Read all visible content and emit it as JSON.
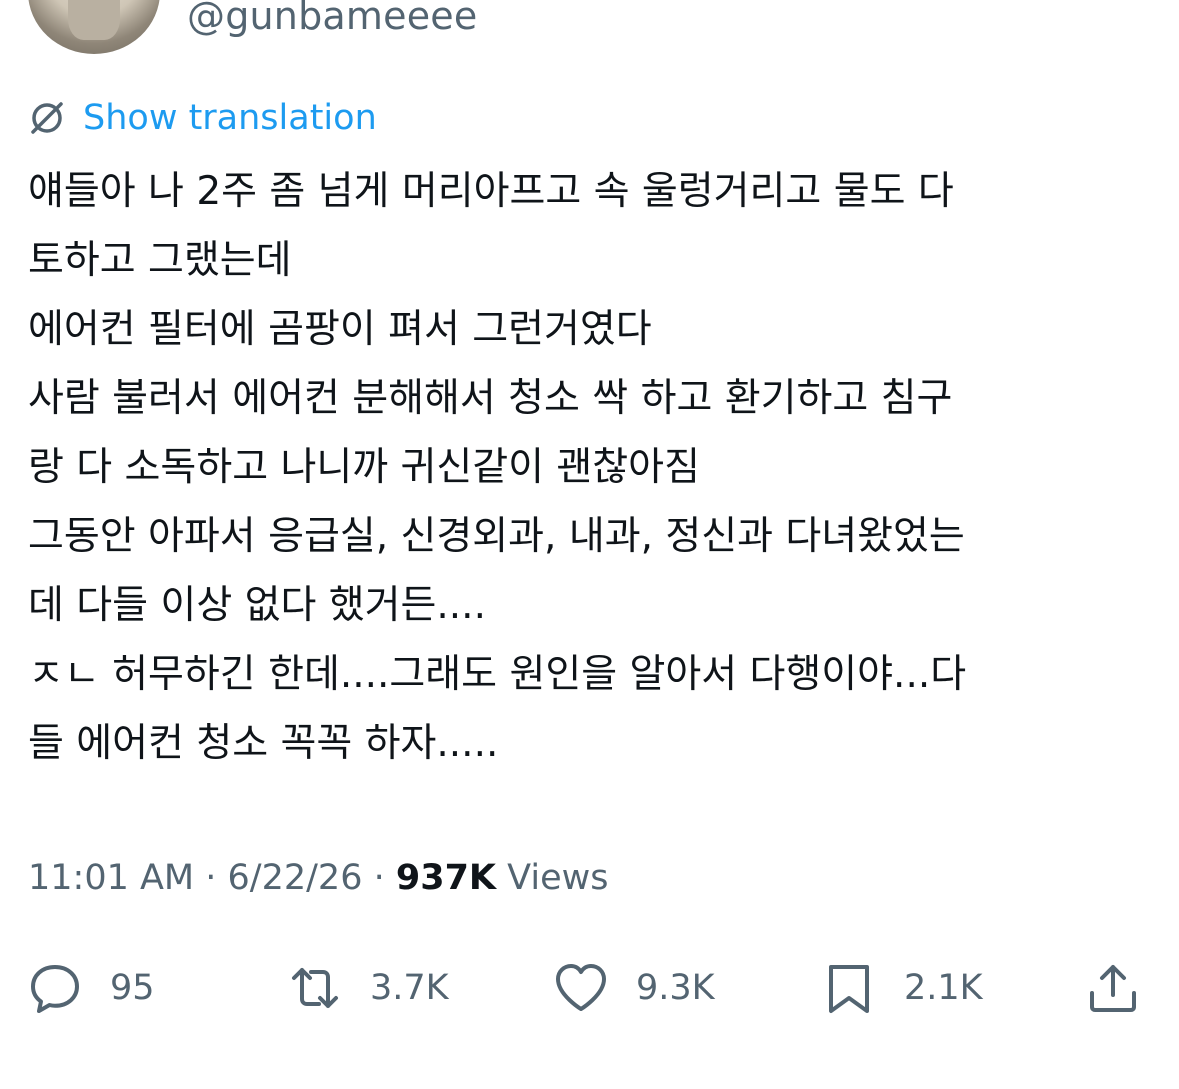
{
  "author": {
    "handle": "@gunbameeee"
  },
  "translation": {
    "label": "Show translation",
    "icon": "translate-icon"
  },
  "tweet": {
    "lines": [
      "얘들아 나 2주 좀 넘게 머리아프고 속 울렁거리고 물도 다",
      "토하고 그랬는데",
      "에어컨 필터에 곰팡이 펴서 그런거였다",
      "사람 불러서 에어컨 분해해서 청소 싹 하고 환기하고 침구",
      "랑 다 소독하고 나니까 귀신같이 괜찮아짐",
      "그동안 아파서 응급실, 신경외과, 내과, 정신과 다녀왔었는",
      "데 다들 이상 없다 했거든....",
      "ㅈㄴ 허무하긴 한데....그래도 원인을 알아서 다행이야...다",
      "들 에어컨 청소 꼭꼭 하자....."
    ]
  },
  "meta": {
    "time": "11:01 AM",
    "separator": " · ",
    "date": "6/22/26",
    "views_count": "937K",
    "views_label": " Views"
  },
  "actions": {
    "reply": {
      "count": "95",
      "icon": "reply-icon"
    },
    "retweet": {
      "count": "3.7K",
      "icon": "retweet-icon"
    },
    "like": {
      "count": "9.3K",
      "icon": "heart-icon"
    },
    "bookmark": {
      "count": "2.1K",
      "icon": "bookmark-icon"
    },
    "share": {
      "icon": "share-icon"
    }
  },
  "colors": {
    "link": "#1d9bf0",
    "secondary": "#536471",
    "text": "#0f1419"
  }
}
